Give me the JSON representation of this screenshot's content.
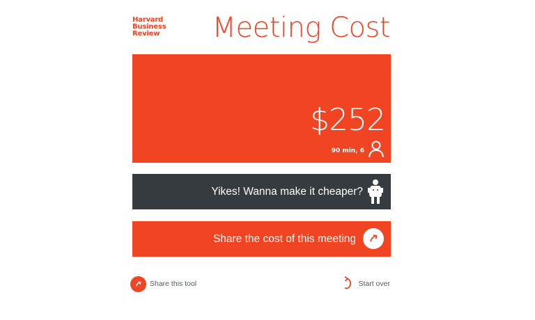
{
  "brand": {
    "logo_lines": [
      "Harvard",
      "Business",
      "Review"
    ],
    "color": "#f04423"
  },
  "title": "Meeting Cost",
  "result": {
    "amount": "$252",
    "details": "90 min, 6",
    "icon": "person-icon"
  },
  "cheaper_cta": {
    "label": "Yikes! Wanna make it cheaper?",
    "icon": "overweight-figure-icon",
    "color": "#353b3e"
  },
  "share_cta": {
    "label": "Share the cost of this meeting",
    "icon": "arrow-circle-icon"
  },
  "footer": {
    "share_label": "Share this tool",
    "restart_label": "Start over"
  }
}
